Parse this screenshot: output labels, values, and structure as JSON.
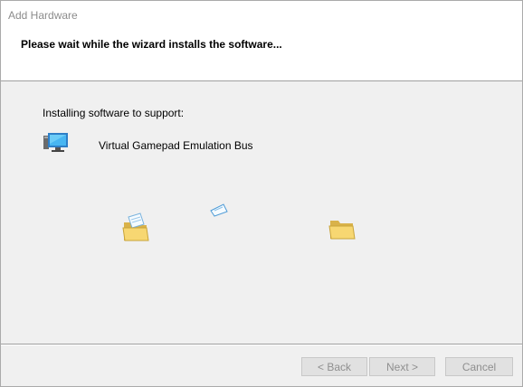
{
  "window": {
    "title": "Add Hardware"
  },
  "header": {
    "title": "Please wait while the wizard installs the software..."
  },
  "content": {
    "installing_label": "Installing software to support:",
    "device_icon": "monitor-icon",
    "device_name": "Virtual Gamepad Emulation Bus",
    "animation_icons": [
      "source-folder-icon",
      "flying-document-icon",
      "destination-folder-icon"
    ]
  },
  "buttons": {
    "back": "< Back",
    "next": "Next >",
    "cancel": "Cancel",
    "enabled": false
  },
  "colors": {
    "title_text": "#8c8c8c",
    "disabled_text": "#8f8f8f",
    "background": "#f0f0f0",
    "header_bg": "#ffffff"
  }
}
